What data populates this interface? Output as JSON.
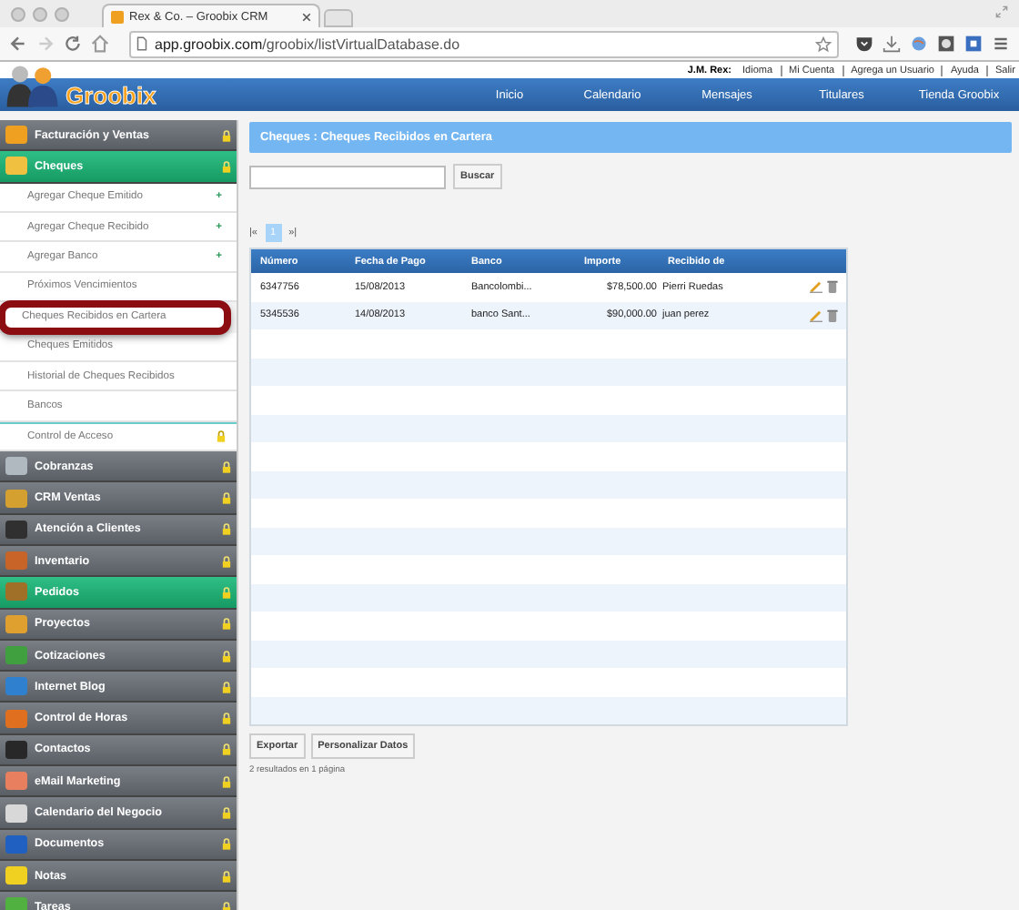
{
  "browser": {
    "tab_title": "Rex & Co. – Groobix CRM",
    "url_host": "app.groobix.com",
    "url_path": "/groobix/listVirtualDatabase.do"
  },
  "user_bar": {
    "user": "J.M. Rex:",
    "links": [
      "Idioma",
      "Mi Cuenta",
      "Agrega un Usuario",
      "Ayuda",
      "Salir"
    ]
  },
  "logo": "Groobix",
  "nav": [
    "Inicio",
    "Calendario",
    "Mensajes",
    "Titulares",
    "Tienda Groobix"
  ],
  "sidebar": [
    {
      "kind": "section",
      "label": "Facturación y Ventas",
      "selected": false,
      "color": "#f0a020"
    },
    {
      "kind": "section",
      "label": "Cheques",
      "selected": true,
      "color": "#f0c040",
      "children": [
        {
          "label": "Agregar Cheque Emitido",
          "plus": "+",
          "highlighted": false
        },
        {
          "label": "Agregar Cheque Recibido",
          "plus": "+",
          "highlighted": false
        },
        {
          "label": "Agregar Banco",
          "plus": "+",
          "highlighted": false
        },
        {
          "label": "Próximos Vencimientos",
          "highlighted": false
        },
        {
          "label": "Cheques Recibidos en Cartera",
          "highlighted": true
        },
        {
          "label": "Cheques Emitidos",
          "highlighted": false
        },
        {
          "label": "Historial de Cheques Recibidos",
          "highlighted": false
        },
        {
          "label": "Bancos",
          "highlighted": false
        }
      ]
    },
    {
      "kind": "access",
      "label": "Control de Acceso",
      "selected": false
    },
    {
      "kind": "section",
      "label": "Cobranzas",
      "selected": false,
      "color": "#b0b8c0"
    },
    {
      "kind": "section",
      "label": "CRM Ventas",
      "selected": false,
      "color": "#d4a030"
    },
    {
      "kind": "section",
      "label": "Atención a Clientes",
      "selected": false,
      "color": "#303030"
    },
    {
      "kind": "section",
      "label": "Inventario",
      "selected": false,
      "color": "#c86428"
    },
    {
      "kind": "section",
      "label": "Pedidos",
      "selected": true,
      "color": "#a07028"
    },
    {
      "kind": "section",
      "label": "Proyectos",
      "selected": false,
      "color": "#e0a030"
    },
    {
      "kind": "section",
      "label": "Cotizaciones",
      "selected": false,
      "color": "#40a040"
    },
    {
      "kind": "section",
      "label": "Internet Blog",
      "selected": false,
      "color": "#3080d0"
    },
    {
      "kind": "section",
      "label": "Control de Horas",
      "selected": false,
      "color": "#e07020"
    },
    {
      "kind": "section",
      "label": "Contactos",
      "selected": false,
      "color": "#282828"
    },
    {
      "kind": "section",
      "label": "eMail Marketing",
      "selected": false,
      "color": "#e88060"
    },
    {
      "kind": "section",
      "label": "Calendario del Negocio",
      "selected": false,
      "color": "#d8d8d8"
    },
    {
      "kind": "section",
      "label": "Documentos",
      "selected": false,
      "color": "#2060c0"
    },
    {
      "kind": "section",
      "label": "Notas",
      "selected": false,
      "color": "#f0d020"
    },
    {
      "kind": "section",
      "label": "Tareas",
      "selected": false,
      "color": "#50b040"
    }
  ],
  "page_title": "Cheques : Cheques Recibidos en Cartera",
  "search": {
    "button": "Buscar"
  },
  "pager": {
    "first": "|«",
    "pages": [
      {
        "label": "1",
        "selected": true
      }
    ],
    "last": "»|"
  },
  "table": {
    "columns": [
      "Número",
      "Fecha de Pago",
      "Banco",
      "Importe",
      "Recibido de"
    ],
    "rows": [
      [
        "6347756",
        "15/08/2013",
        "Bancolombi...",
        "$78,500.00",
        "Pierri Ruedas"
      ],
      [
        "5345536",
        "14/08/2013",
        "banco Sant...",
        "$90,000.00",
        "juan perez"
      ]
    ]
  },
  "buttons": [
    "Exportar",
    "Personalizar Datos"
  ],
  "results": "2 resultados en 1 página"
}
